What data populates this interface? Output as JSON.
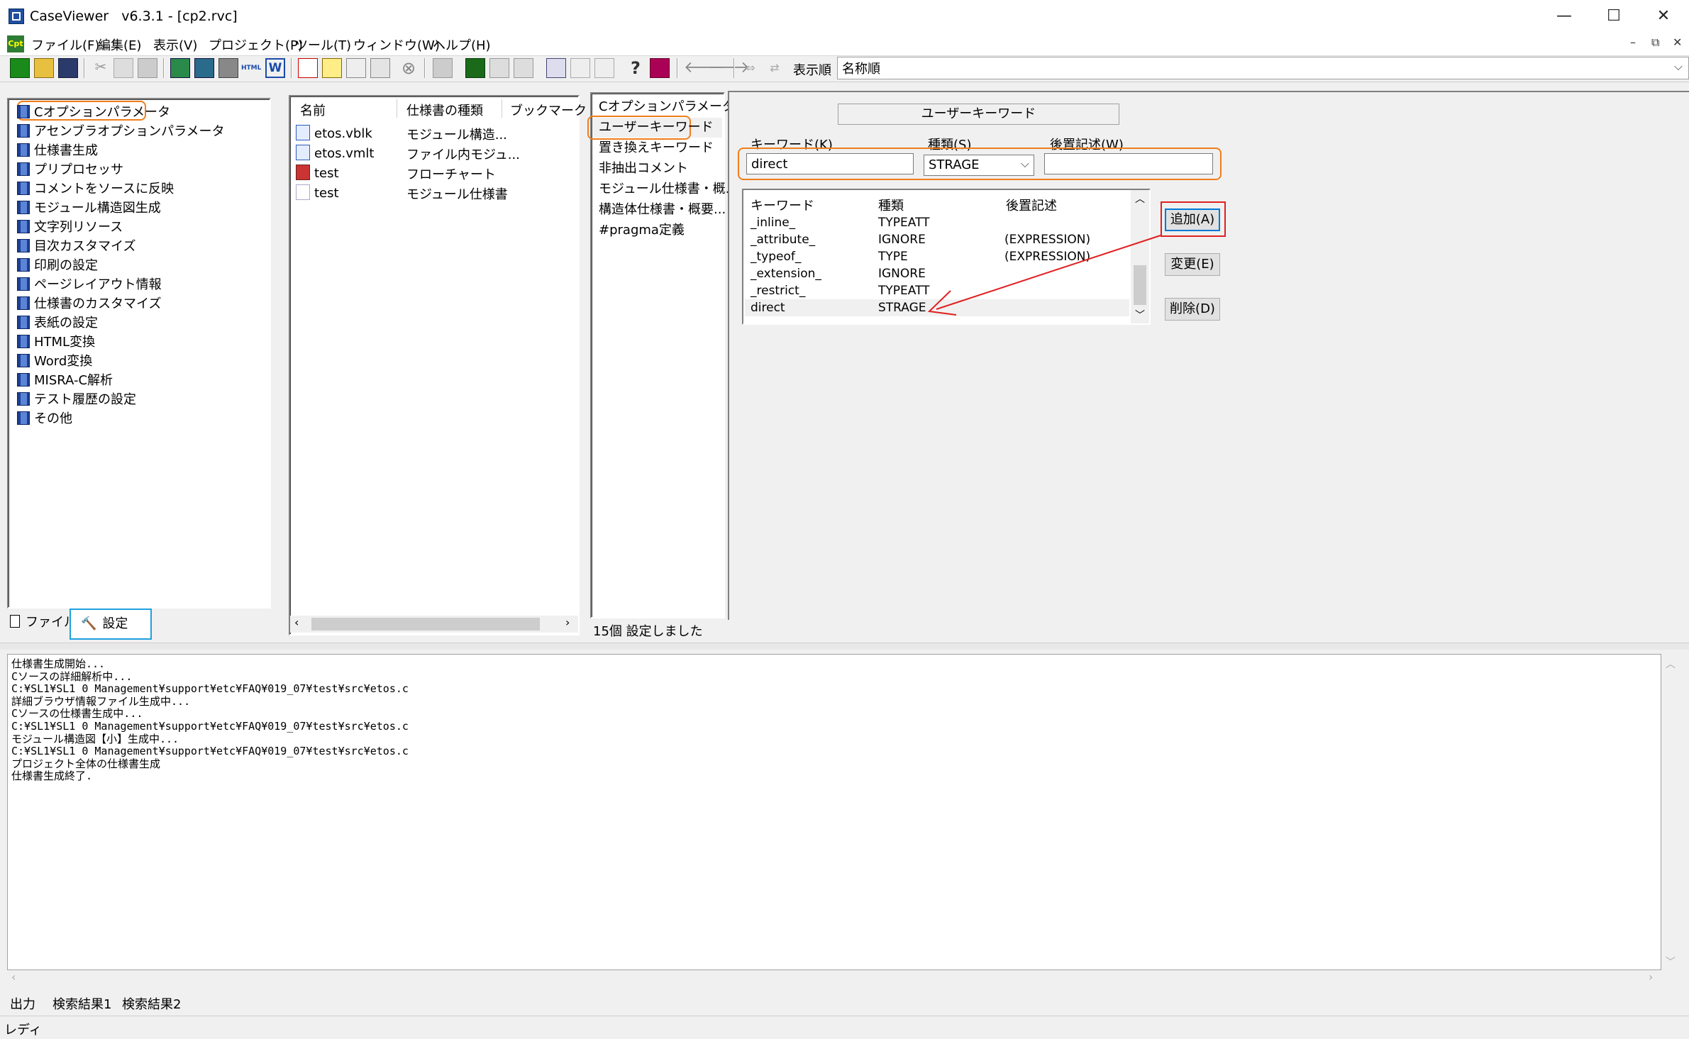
{
  "window": {
    "title": "CaseViewer   v6.3.1 - [cp2.rvc]",
    "minimize": "—",
    "maximize": "☐",
    "close": "✕"
  },
  "menu": [
    "ファイル(F)",
    "編集(E)",
    "表示(V)",
    "プロジェクト(P)",
    "ツール(T)",
    "ウィンドウ(W)",
    "ヘルプ(H)"
  ],
  "mdi_controls": [
    "–",
    "⧉",
    "✕"
  ],
  "toolbar": {
    "sort_label": "表示順",
    "sort_value": "名称順"
  },
  "left_tree": {
    "items": [
      "Cオプションパラメータ",
      "アセンブラオプションパラメータ",
      "仕様書生成",
      "プリプロセッサ",
      "コメントをソースに反映",
      "モジュール構造図生成",
      "文字列リソース",
      "目次カスタマイズ",
      "印刷の設定",
      "ページレイアウト情報",
      "仕様書のカスタマイズ",
      "表紙の設定",
      "HTML変換",
      "Word変換",
      "MISRA-C解析",
      "テスト履歴の設定",
      "その他"
    ],
    "tabs": [
      "ファイル",
      "設定"
    ]
  },
  "file_list": {
    "columns": [
      "名前",
      "仕様書の種類",
      "ブックマーク"
    ],
    "rows": [
      {
        "name": "etos.vblk",
        "type": "モジュール構造..."
      },
      {
        "name": "etos.vmlt",
        "type": "ファイル内モジュ..."
      },
      {
        "name": "test",
        "type": "フローチャート"
      },
      {
        "name": "test",
        "type": "モジュール仕様書"
      }
    ]
  },
  "nav_list": {
    "items": [
      "Cオプションパラメータ...",
      "ユーザーキーワード",
      "置き換えキーワード",
      "非抽出コメント",
      "モジュール仕様書・概...",
      "構造体仕様書・概要...",
      "#pragma定義"
    ],
    "status": "15個 設定しました"
  },
  "user_keyword": {
    "header": "ユーザーキーワード",
    "keyword_label": "キーワード(K)",
    "type_label": "種類(S)",
    "postfix_label": "後置記述(W)",
    "keyword_value": "direct",
    "type_value": "STRAGE",
    "postfix_value": "",
    "list_columns": [
      "キーワード",
      "種類",
      "後置記述"
    ],
    "list_rows": [
      {
        "keyword": "_inline_",
        "type": "TYPEATT",
        "postfix": ""
      },
      {
        "keyword": "_attribute_",
        "type": "IGNORE",
        "postfix": "(EXPRESSION)"
      },
      {
        "keyword": "_typeof_",
        "type": "TYPE",
        "postfix": "(EXPRESSION)"
      },
      {
        "keyword": "_extension_",
        "type": "IGNORE",
        "postfix": ""
      },
      {
        "keyword": "_restrict_",
        "type": "TYPEATT",
        "postfix": ""
      },
      {
        "keyword": "direct",
        "type": "STRAGE",
        "postfix": ""
      }
    ],
    "buttons": {
      "add": "追加(A)",
      "change": "変更(E)",
      "delete": "削除(D)"
    }
  },
  "output": {
    "lines": [
      "仕様書生成開始...",
      "Cソースの詳細解析中...",
      "C:¥SL1¥SL1 0 Management¥support¥etc¥FAQ¥019_07¥test¥src¥etos.c",
      "詳細ブラウザ情報ファイル生成中...",
      "Cソースの仕様書生成中...",
      "C:¥SL1¥SL1 0 Management¥support¥etc¥FAQ¥019_07¥test¥src¥etos.c",
      "モジュール構造図【小】生成中...",
      "C:¥SL1¥SL1 0 Management¥support¥etc¥FAQ¥019_07¥test¥src¥etos.c",
      "プロジェクト全体の仕様書生成",
      "仕様書生成終了."
    ],
    "tabs": [
      "出力",
      "検索結果1",
      "検索結果2"
    ]
  },
  "statusbar": {
    "text": "レディ"
  },
  "colors": {
    "highlight_orange": "#f07e1c",
    "highlight_blue": "#1ea0e0",
    "highlight_red": "#e02020",
    "selection": "#f0f0f0"
  }
}
